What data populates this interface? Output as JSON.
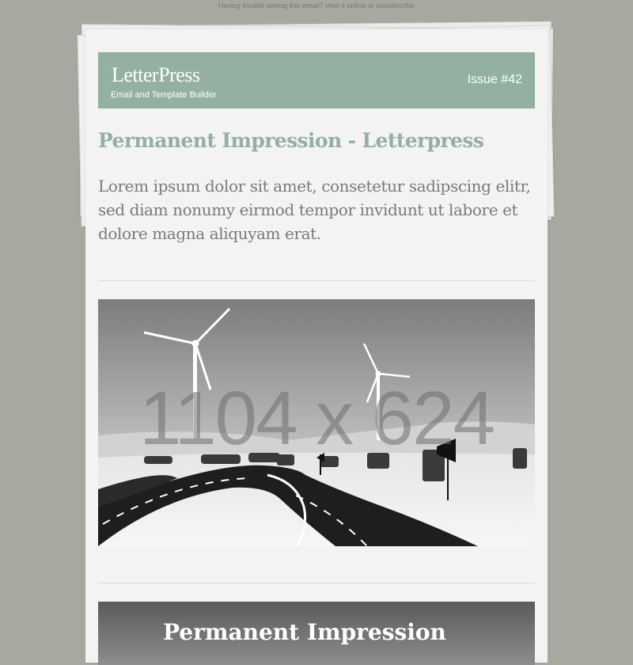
{
  "preheader": {
    "text": "Having trouble seeing this email? view it online or unsubscribe"
  },
  "header": {
    "logo": "LetterPress",
    "tagline": "Email and Template Builder",
    "issue": "Issue #42",
    "background_color": "#93b0a1"
  },
  "article": {
    "headline": "Permanent Impression - Letterpress",
    "lead": "Lorem ipsum dolor sit amet, consetetur sadipscing elitr, sed diam nonumy eirmod tempor invidunt ut labore et dolore magna aliquyam erat."
  },
  "hero_image": {
    "placeholder_label": "1104 x 624",
    "subject": "wind turbines and winding road, black and white"
  },
  "banner": {
    "title": "Permanent Impression"
  },
  "colors": {
    "page_background": "#a8a8a0",
    "card_background": "#f3f3f3",
    "accent": "#93b0a1",
    "body_text": "#7a7a7a"
  }
}
